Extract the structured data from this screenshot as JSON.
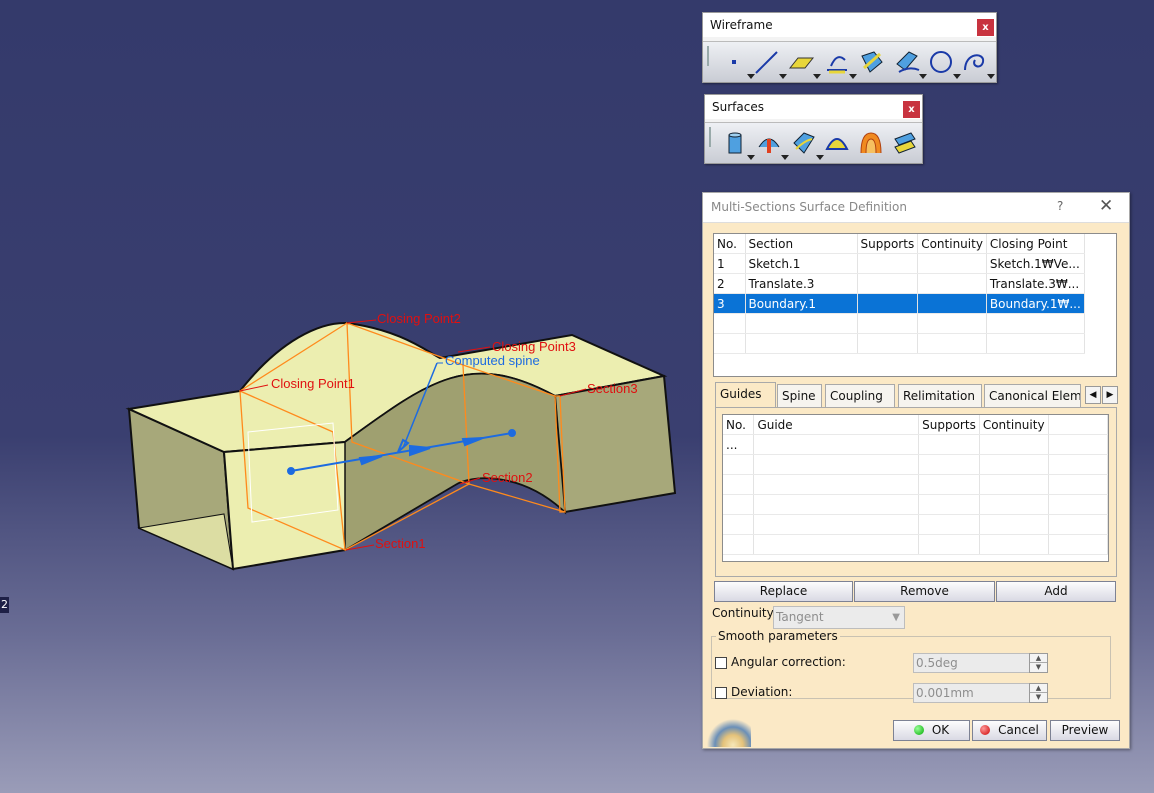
{
  "viewport": {
    "side_label": "2",
    "annotations": {
      "closing_point_1": "Closing Point1",
      "closing_point_2": "Closing Point2",
      "closing_point_3": "Closing Point3",
      "computed_spine": "Computed spine",
      "section_1": "Section1",
      "section_2": "Section2",
      "section_3": "Section3"
    },
    "colors": {
      "surface": "#eceeb0",
      "surface_dark": "#a7a87a",
      "annotation": "#e01010",
      "spine": "#1d6be0",
      "section_lines": "#ff8a1c"
    }
  },
  "wireframe_toolbar": {
    "title": "Wireframe",
    "close": "x",
    "tools": [
      "point-icon",
      "line-icon",
      "plane-icon",
      "projection-icon",
      "intersection-icon",
      "offset-curve-icon",
      "circle-icon",
      "spline-icon"
    ]
  },
  "surfaces_toolbar": {
    "title": "Surfaces",
    "close": "x",
    "tools": [
      "extrude-icon",
      "revolve-icon",
      "sweep-icon",
      "fill-icon",
      "multi-sections-icon",
      "blend-icon"
    ]
  },
  "dialog": {
    "title": "Multi-Sections Surface Definition",
    "help": "?",
    "close": "✕",
    "sections_table": {
      "columns": [
        "No.",
        "Section",
        "Supports",
        "Continuity",
        "Closing Point"
      ],
      "rows": [
        {
          "no": "1",
          "section": "Sketch.1",
          "supports": "",
          "continuity": "",
          "closing_point": "Sketch.1₩Ve..."
        },
        {
          "no": "2",
          "section": "Translate.3",
          "supports": "",
          "continuity": "",
          "closing_point": "Translate.3₩..."
        },
        {
          "no": "3",
          "section": "Boundary.1",
          "supports": "",
          "continuity": "",
          "closing_point": "Boundary.1₩..."
        }
      ]
    },
    "tabs": [
      "Guides",
      "Spine",
      "Coupling",
      "Relimitation",
      "Canonical Eleme"
    ],
    "guides_table": {
      "columns": [
        "No.",
        "Guide",
        "Supports",
        "Continuity"
      ],
      "rows": [
        {
          "no": "...",
          "guide": "",
          "supports": "",
          "continuity": ""
        }
      ]
    },
    "buttons": {
      "replace": "Replace",
      "remove": "Remove",
      "add": "Add"
    },
    "continuity_label": "Continuity:",
    "continuity_value": "Tangent",
    "smooth": {
      "legend": "Smooth parameters",
      "angular_label": "Angular correction:",
      "angular_value": "0.5deg",
      "deviation_label": "Deviation:",
      "deviation_value": "0.001mm",
      "angular_checked": false,
      "deviation_checked": false
    },
    "footer": {
      "ok": "OK",
      "cancel": "Cancel",
      "preview": "Preview"
    }
  }
}
